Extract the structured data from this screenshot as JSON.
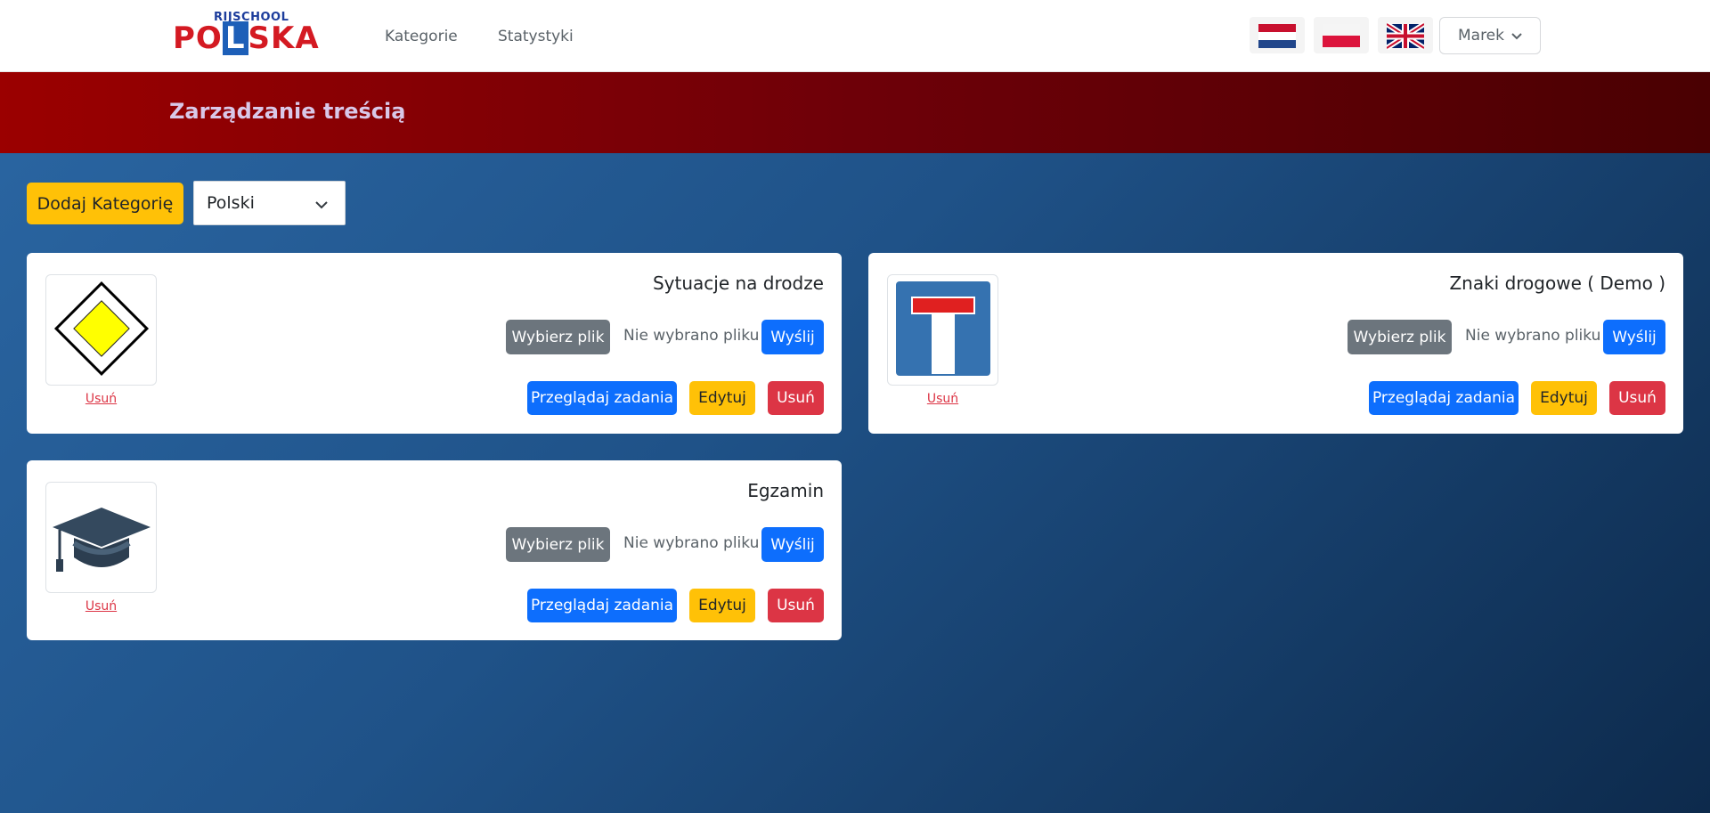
{
  "navbar": {
    "logo_top": "RIJSCHOOL",
    "logo_main_a": "PO",
    "logo_main_l": "L",
    "logo_main_b": "SKA",
    "links": [
      "Kategorie",
      "Statystyki"
    ],
    "flags": [
      "netherlands-flag",
      "poland-flag",
      "uk-flag"
    ],
    "user": "Marek"
  },
  "banner": {
    "title": "Zarządzanie treścią"
  },
  "toolbar": {
    "add_category": "Dodaj Kategorię",
    "language_selected": "Polski"
  },
  "card_labels": {
    "choose_file": "Wybierz plik",
    "no_file": "Nie wybrano pliku",
    "send": "Wyślij",
    "browse": "Przeglądaj zadania",
    "edit": "Edytuj",
    "delete": "Usuń",
    "remove_image": "Usuń"
  },
  "categories": [
    {
      "title": "Sytuacje na drodze",
      "image": "priority-road-sign-icon"
    },
    {
      "title": "Znaki drogowe ( Demo )",
      "image": "dead-end-sign-icon"
    },
    {
      "title": "Egzamin",
      "image": "graduation-cap-icon"
    }
  ],
  "colors": {
    "primary": "#0d6efd",
    "warning": "#ffc107",
    "danger": "#dc3545",
    "secondary": "#6c757d",
    "banner": "#8b0000"
  }
}
